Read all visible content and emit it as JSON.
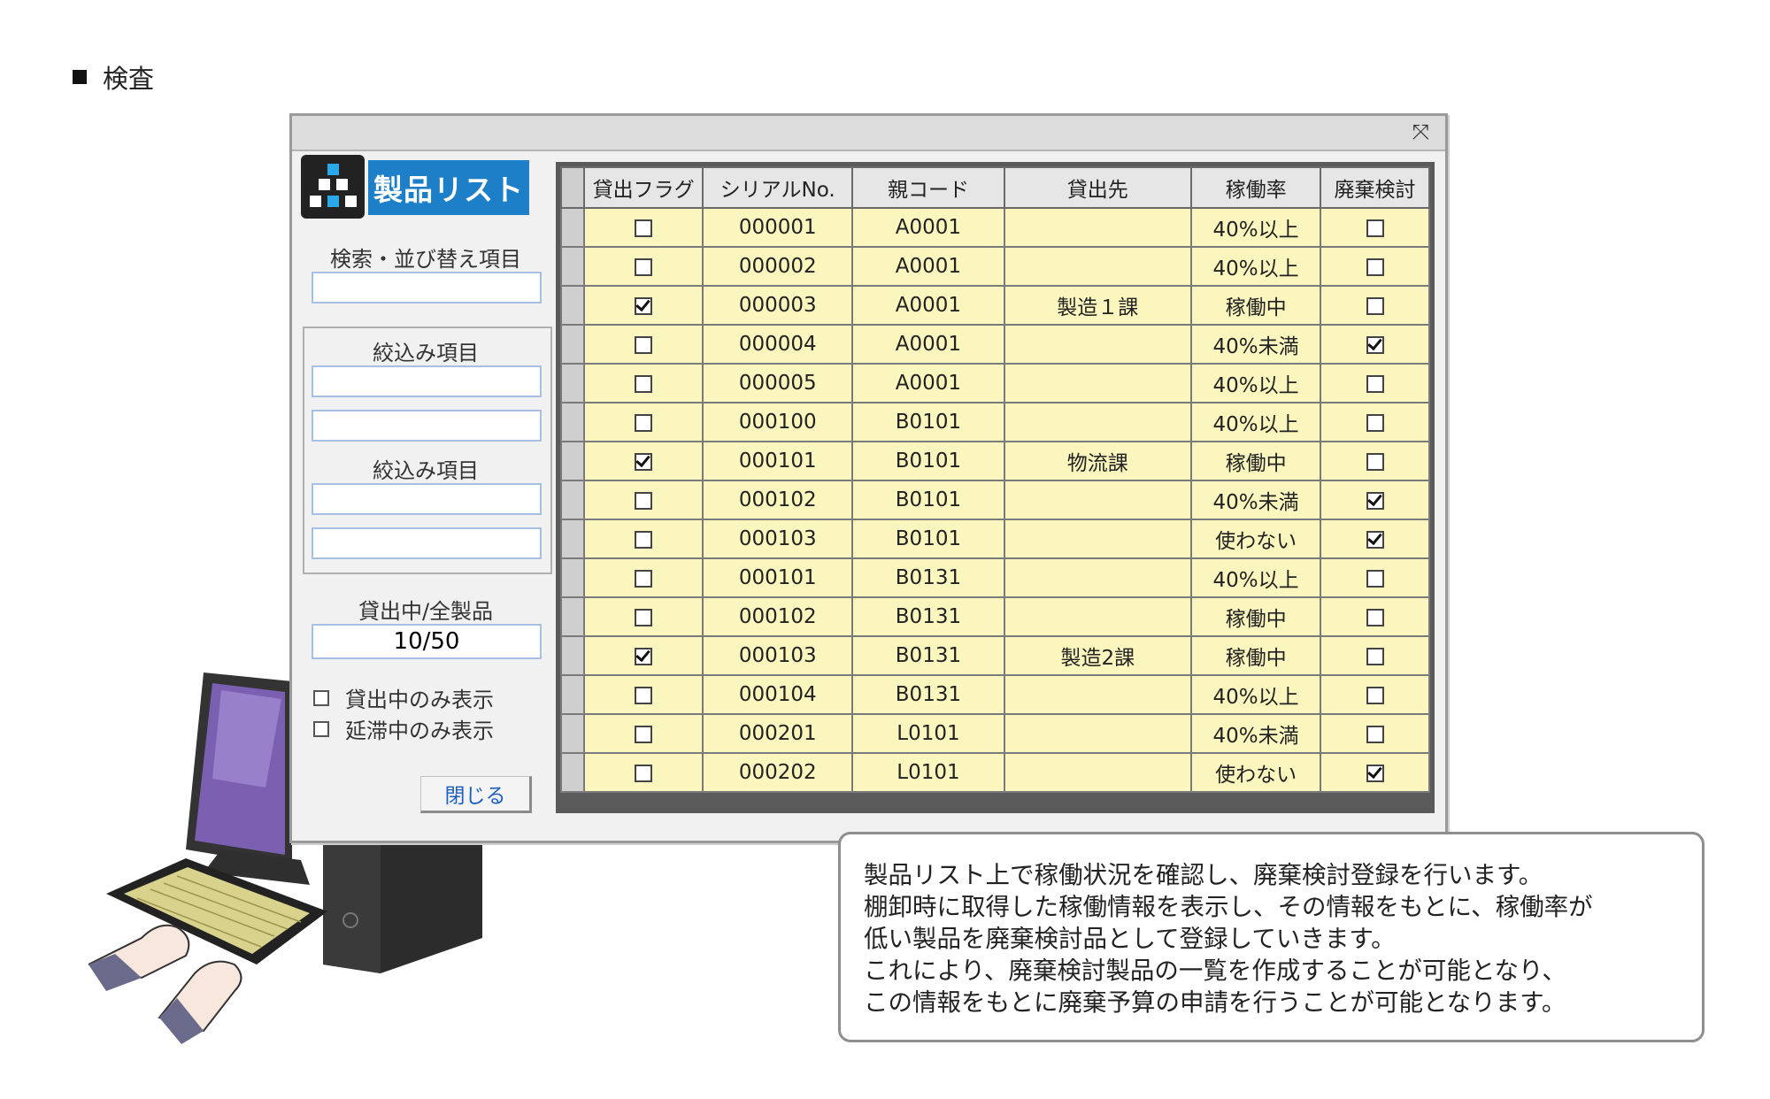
{
  "page": {
    "section_title": "検査"
  },
  "window": {
    "app_title": "製品リスト",
    "close_icon": "close-icon",
    "search_sort_label": "検索・並び替え項目",
    "search_sort_value": "",
    "filter_label_1": "絞込み項目",
    "filter_label_2": "絞込み項目",
    "filter_values": [
      "",
      "",
      "",
      ""
    ],
    "loan_ratio_label": "貸出中/全製品",
    "loan_ratio_value": "10/50",
    "show_on_loan_label": "貸出中のみ表示",
    "show_overdue_label": "延滞中のみ表示",
    "close_button_label": "閉じる"
  },
  "table": {
    "columns": [
      "貸出フラグ",
      "シリアルNo.",
      "親コード",
      "貸出先",
      "稼働率",
      "廃棄検討"
    ],
    "rows": [
      {
        "flag": false,
        "serial": "000001",
        "parent": "A0001",
        "dest": "",
        "rate": "40%以上",
        "disposal": false
      },
      {
        "flag": false,
        "serial": "000002",
        "parent": "A0001",
        "dest": "",
        "rate": "40%以上",
        "disposal": false
      },
      {
        "flag": true,
        "serial": "000003",
        "parent": "A0001",
        "dest": "製造１課",
        "rate": "稼働中",
        "disposal": false
      },
      {
        "flag": false,
        "serial": "000004",
        "parent": "A0001",
        "dest": "",
        "rate": "40%未満",
        "disposal": true
      },
      {
        "flag": false,
        "serial": "000005",
        "parent": "A0001",
        "dest": "",
        "rate": "40%以上",
        "disposal": false
      },
      {
        "flag": false,
        "serial": "000100",
        "parent": "B0101",
        "dest": "",
        "rate": "40%以上",
        "disposal": false
      },
      {
        "flag": true,
        "serial": "000101",
        "parent": "B0101",
        "dest": "物流課",
        "rate": "稼働中",
        "disposal": false
      },
      {
        "flag": false,
        "serial": "000102",
        "parent": "B0101",
        "dest": "",
        "rate": "40%未満",
        "disposal": true
      },
      {
        "flag": false,
        "serial": "000103",
        "parent": "B0101",
        "dest": "",
        "rate": "使わない",
        "disposal": true
      },
      {
        "flag": false,
        "serial": "000101",
        "parent": "B0131",
        "dest": "",
        "rate": "40%以上",
        "disposal": false
      },
      {
        "flag": false,
        "serial": "000102",
        "parent": "B0131",
        "dest": "",
        "rate": "稼働中",
        "disposal": false
      },
      {
        "flag": true,
        "serial": "000103",
        "parent": "B0131",
        "dest": "製造2課",
        "rate": "稼働中",
        "disposal": false
      },
      {
        "flag": false,
        "serial": "000104",
        "parent": "B0131",
        "dest": "",
        "rate": "40%以上",
        "disposal": false
      },
      {
        "flag": false,
        "serial": "000201",
        "parent": "L0101",
        "dest": "",
        "rate": "40%未満",
        "disposal": false
      },
      {
        "flag": false,
        "serial": "000202",
        "parent": "L0101",
        "dest": "",
        "rate": "使わない",
        "disposal": true
      }
    ]
  },
  "callout": {
    "lines": [
      "製品リスト上で稼働状況を確認し、廃棄検討登録を行います。",
      "棚卸時に取得した稼働情報を表示し、その情報をもとに、稼働率が",
      "低い製品を廃棄検討品として登録していきます。",
      "これにより、廃棄検討製品の一覧を作成することが可能となり、",
      "この情報をもとに廃棄予算の申請を行うことが可能となります。"
    ]
  },
  "colors": {
    "accent": "#1d7fc8",
    "cell_bg": "#fbf6bd",
    "grid_border": "#5a5a5a"
  }
}
